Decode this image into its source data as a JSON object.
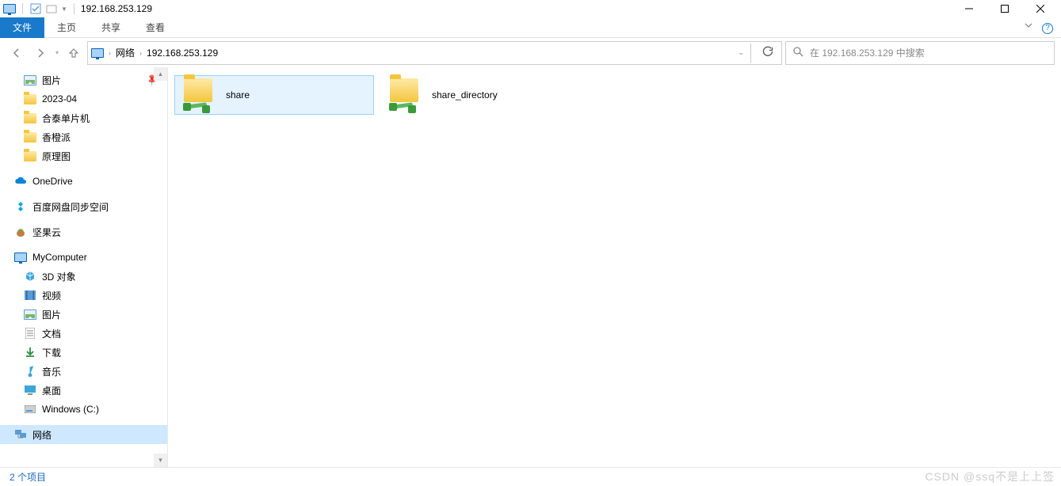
{
  "titleBar": {
    "title": "192.168.253.129"
  },
  "ribbon": {
    "file": "文件",
    "tabs": [
      "主页",
      "共享",
      "查看"
    ]
  },
  "address": {
    "crumbs": [
      "网络",
      "192.168.253.129"
    ]
  },
  "search": {
    "placeholder": "在 192.168.253.129 中搜索"
  },
  "sidebar": {
    "pictures": "图片",
    "folders": [
      "2023-04",
      "合泰单片机",
      "香橙派",
      "原理图"
    ],
    "onedrive": "OneDrive",
    "baidu": "百度网盘同步空间",
    "jianguo": "坚果云",
    "mycomputer": "MyComputer",
    "mycomputer_children": [
      {
        "label": "3D 对象",
        "icon": "cube"
      },
      {
        "label": "视频",
        "icon": "video"
      },
      {
        "label": "图片",
        "icon": "pic"
      },
      {
        "label": "文档",
        "icon": "doc"
      },
      {
        "label": "下载",
        "icon": "download"
      },
      {
        "label": "音乐",
        "icon": "music"
      },
      {
        "label": "桌面",
        "icon": "desktop"
      },
      {
        "label": "Windows (C:)",
        "icon": "drive"
      }
    ],
    "network": "网络"
  },
  "content": {
    "items": [
      {
        "name": "share"
      },
      {
        "name": "share_directory"
      }
    ]
  },
  "status": {
    "text": "2 个项目"
  },
  "watermark": "CSDN @ssq不是上上签"
}
